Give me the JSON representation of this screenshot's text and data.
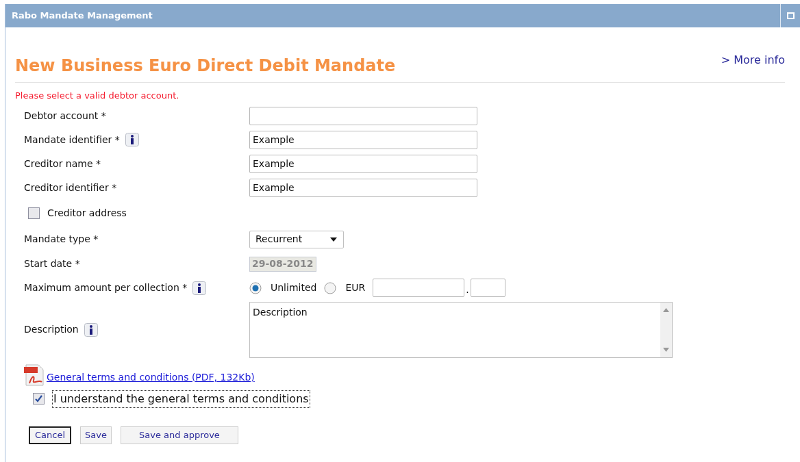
{
  "window": {
    "title": "Rabo Mandate Management"
  },
  "page": {
    "title": "New Business Euro Direct Debit Mandate",
    "more_info": "> More info",
    "error": "Please select a valid debtor account."
  },
  "fields": [
    {
      "kind": "text",
      "label": "Debtor account *",
      "info": false
    },
    {
      "kind": "text",
      "label": "Mandate identifier *",
      "info": true,
      "value": "Example"
    },
    {
      "kind": "text",
      "label": "Creditor name *",
      "info": false,
      "value": "Example"
    },
    {
      "kind": "text",
      "label": "Creditor identifier *",
      "info": false,
      "value": "Example"
    },
    {
      "kind": "checkbox",
      "label": "Creditor address",
      "checked": false
    },
    {
      "kind": "select",
      "label": "Mandate type *",
      "info": false,
      "value": "Recurrent"
    },
    {
      "kind": "date",
      "label": "Start date *",
      "info": false,
      "value": "29-08-2012",
      "disabled": true
    },
    {
      "kind": "amount",
      "label": "Maximum amount per collection *",
      "info": true,
      "options": [
        {
          "label": "Unlimited",
          "selected": true
        },
        {
          "label": "EUR",
          "selected": false
        }
      ],
      "separator": "."
    },
    {
      "kind": "textarea",
      "label": "Description",
      "info": true,
      "value": "Description"
    }
  ],
  "terms": {
    "link": "General terms and conditions (PDF, 132Kb)",
    "confirm": "I understand the general terms and conditions",
    "checked": true
  },
  "buttons": [
    {
      "label": "Cancel",
      "focused": true
    },
    {
      "label": "Save",
      "focused": false
    },
    {
      "label": "Save and approve",
      "focused": false
    }
  ]
}
